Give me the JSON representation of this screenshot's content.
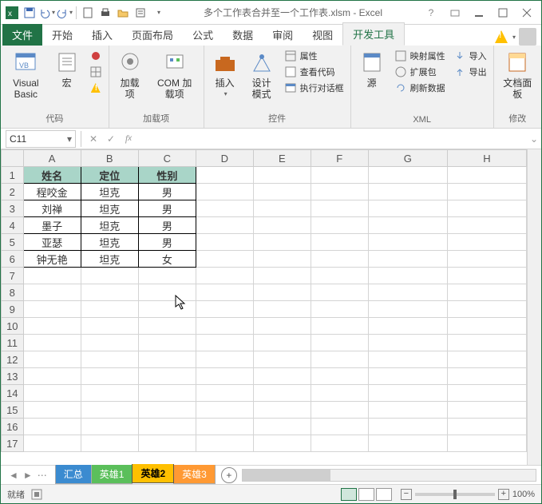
{
  "title": "多个工作表合并至一个工作表.xlsm - Excel",
  "tabs": {
    "file": "文件",
    "home": "开始",
    "insert": "插入",
    "layout": "页面布局",
    "formula": "公式",
    "data": "数据",
    "review": "审阅",
    "view": "视图",
    "dev": "开发工具"
  },
  "ribbon": {
    "code": {
      "label": "代码",
      "vb": "Visual Basic",
      "macro": "宏"
    },
    "addins": {
      "label": "加载项",
      "addin": "加载项",
      "com": "COM 加载项"
    },
    "controls": {
      "label": "控件",
      "insert": "插入",
      "design": "设计模式",
      "props": "属性",
      "viewcode": "查看代码",
      "rundlg": "执行对话框"
    },
    "xml": {
      "label": "XML",
      "source": "源",
      "mapprops": "映射属性",
      "expand": "扩展包",
      "refresh": "刷新数据",
      "import": "导入",
      "export": "导出"
    },
    "modify": {
      "label": "修改",
      "docpanel": "文档面板"
    }
  },
  "namebox": "C11",
  "columns": [
    "A",
    "B",
    "C",
    "D",
    "E",
    "F",
    "G",
    "H"
  ],
  "rows": [
    "1",
    "2",
    "3",
    "4",
    "5",
    "6",
    "7",
    "8",
    "9",
    "10",
    "11",
    "12",
    "13",
    "14",
    "15",
    "16",
    "17"
  ],
  "table": {
    "headers": [
      "姓名",
      "定位",
      "性别"
    ],
    "rows": [
      [
        "程咬金",
        "坦克",
        "男"
      ],
      [
        "刘禅",
        "坦克",
        "男"
      ],
      [
        "墨子",
        "坦克",
        "男"
      ],
      [
        "亚瑟",
        "坦克",
        "男"
      ],
      [
        "钟无艳",
        "坦克",
        "女"
      ]
    ]
  },
  "sheets": {
    "s1": "汇总",
    "s2": "英雄1",
    "s3": "英雄2",
    "s4": "英雄3"
  },
  "status": {
    "ready": "就绪",
    "zoom": "100%"
  }
}
